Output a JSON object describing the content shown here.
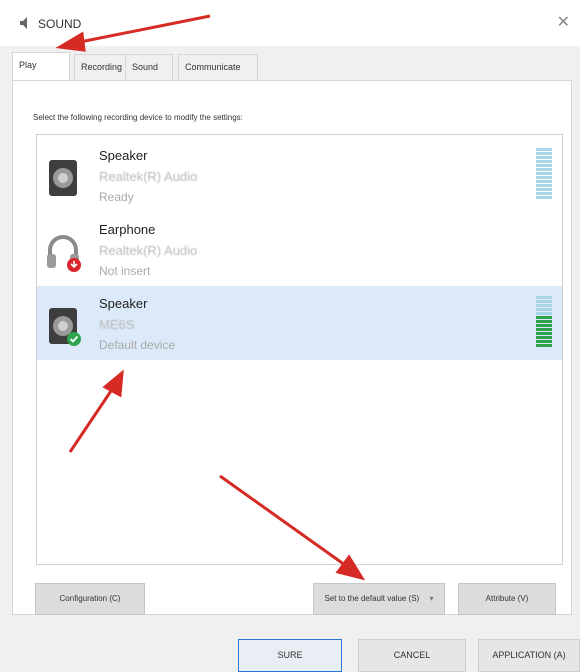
{
  "window": {
    "title": "SOUND",
    "close_icon": "close-icon"
  },
  "tabs": [
    {
      "label": "Play",
      "active": true
    },
    {
      "label": "Recording",
      "active": false
    },
    {
      "label": "Sound",
      "active": false
    },
    {
      "label": "Communicate",
      "active": false
    }
  ],
  "instruction": "Select the following recording device to modify the settings:",
  "devices": [
    {
      "name": "Speaker",
      "driver": "Realtek(R) Audio",
      "status": "Ready",
      "icon": "speaker-icon",
      "selected": false
    },
    {
      "name": "Earphone",
      "driver": "Realtek(R) Audio",
      "status": "Not insert",
      "icon": "headphones-icon",
      "selected": false
    },
    {
      "name": "Speaker",
      "driver": "ME6S",
      "status": "Default device",
      "icon": "speaker-icon",
      "selected": true
    }
  ],
  "buttons": {
    "configuration": "Configuration (C)",
    "set_default": "Set to the default value (S)",
    "attribute": "Attribute (V)"
  },
  "footer": {
    "sure": "SURE",
    "cancel": "CANCEL",
    "application": "APPLICATION (A)"
  },
  "colors": {
    "selected_bg": "#dbe9f8",
    "level_on": "#2ea44f",
    "annotation_arrow": "#d62a24"
  }
}
